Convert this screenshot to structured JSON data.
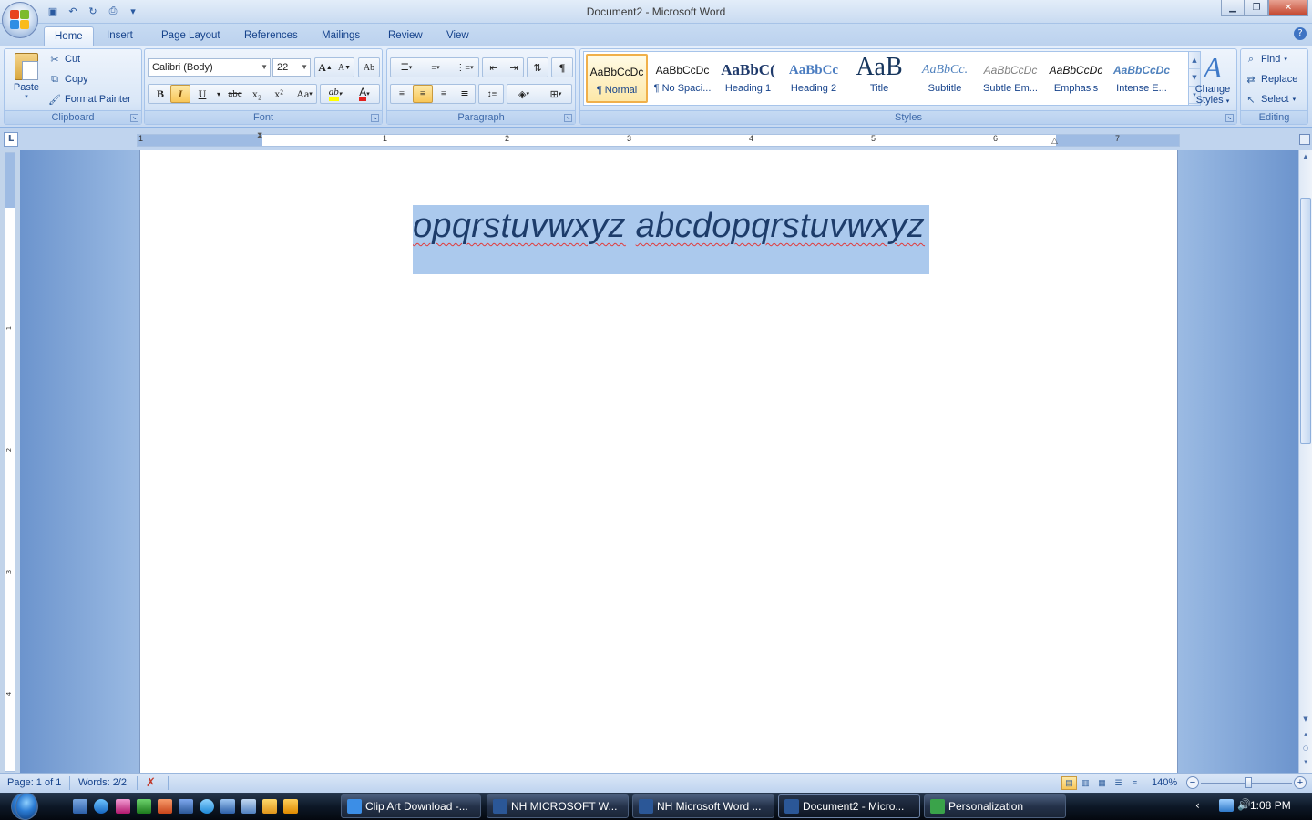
{
  "window": {
    "title": "Document2 - Microsoft Word",
    "controls": {
      "minimize": "▁",
      "maximize": "❐",
      "close": "✕"
    }
  },
  "quick_access": [
    {
      "name": "save-icon",
      "glyph": "💾"
    },
    {
      "name": "undo-icon",
      "glyph": "↶"
    },
    {
      "name": "redo-icon",
      "glyph": "↻"
    },
    {
      "name": "print-preview-icon",
      "glyph": "🔍"
    },
    {
      "name": "customize-qat-icon",
      "glyph": "▾"
    }
  ],
  "tabs": [
    "Home",
    "Insert",
    "Page Layout",
    "References",
    "Mailings",
    "Review",
    "View"
  ],
  "active_tab": "Home",
  "help": "?",
  "clipboard": {
    "label": "Clipboard",
    "paste": "Paste",
    "cut": "Cut",
    "copy": "Copy",
    "format_painter": "Format Painter"
  },
  "font": {
    "label": "Font",
    "family": "Calibri (Body)",
    "size": "22",
    "grow": "A",
    "shrink": "A",
    "bold": "B",
    "italic": "I",
    "underline": "U",
    "strike": "abc",
    "subscript": "x₂",
    "superscript": "x²",
    "change_case": "Aa",
    "highlight": "ab",
    "font_color": "A"
  },
  "paragraph": {
    "label": "Paragraph",
    "show_marks": "¶"
  },
  "styles": {
    "label": "Styles",
    "items": [
      {
        "sample": "AaBbCcDc",
        "name": "¶ Normal"
      },
      {
        "sample": "AaBbCcDc",
        "name": "¶ No Spaci..."
      },
      {
        "sample": "AaBbC(",
        "name": "Heading 1"
      },
      {
        "sample": "AaBbCc",
        "name": "Heading 2"
      },
      {
        "sample": "AaB",
        "name": "Title"
      },
      {
        "sample": "AaBbCc.",
        "name": "Subtitle"
      },
      {
        "sample": "AaBbCcDc",
        "name": "Subtle Em..."
      },
      {
        "sample": "AaBbCcDc",
        "name": "Emphasis"
      },
      {
        "sample": "AaBbCcDc",
        "name": "Intense E..."
      }
    ],
    "selected_index": 0,
    "change_styles_1": "Change",
    "change_styles_2": "Styles"
  },
  "editing": {
    "label": "Editing",
    "find": "Find",
    "replace": "Replace",
    "select": "Select"
  },
  "ruler": {
    "tab_selector": "L",
    "numbers": [
      "1",
      "1",
      "2",
      "3",
      "4",
      "5",
      "6",
      "7"
    ],
    "vnumbers": [
      "1",
      "2",
      "3",
      "4"
    ]
  },
  "document": {
    "word1": "opqrstuvwxyz",
    "word2": "abcdopqrstuvwxyz"
  },
  "status": {
    "page": "Page: 1 of 1",
    "words": "Words: 2/2",
    "zoom": "140%",
    "zoom_minus": "−",
    "zoom_plus": "+"
  },
  "taskbar": {
    "buttons": [
      {
        "label": "Clip Art Download -...",
        "color": "#3c8ee6"
      },
      {
        "label": "NH MICROSOFT W...",
        "color": "#2b5797"
      },
      {
        "label": "NH Microsoft Word ...",
        "color": "#2b5797"
      },
      {
        "label": "Document2 - Micro...",
        "color": "#2b5797"
      },
      {
        "label": "Personalization",
        "color": "#3aa34a"
      }
    ],
    "active_index": 3,
    "clock": "1:08 PM"
  },
  "colors": {
    "selection": "#abc9ed",
    "text": "#1d3c6a",
    "ribbon_text": "#15428b",
    "font_color_swatch": "#e2201e",
    "highlight_swatch": "#ffff00"
  }
}
